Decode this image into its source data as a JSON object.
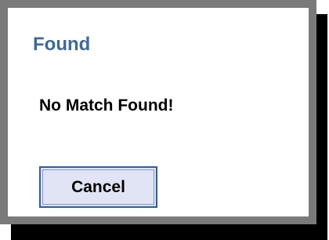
{
  "dialog": {
    "title": "Found",
    "message": "No Match Found!",
    "cancel_label": "Cancel"
  },
  "colors": {
    "title": "#3a6a9e",
    "frame": "#7a7a7a",
    "button_bg": "#e1e4f5",
    "button_border": "#2c5bb5"
  }
}
